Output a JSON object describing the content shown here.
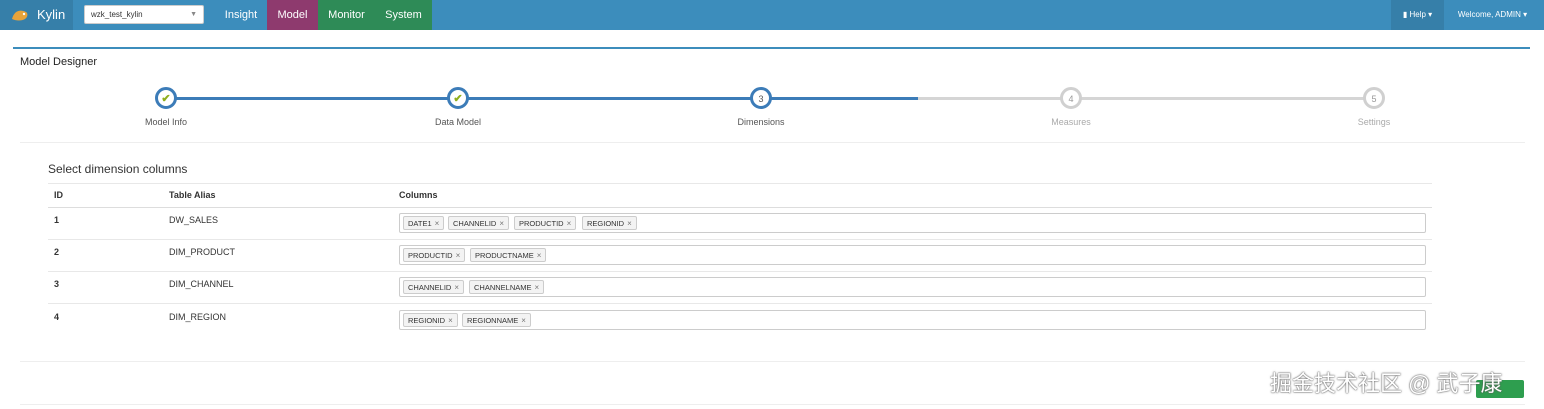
{
  "navbar": {
    "brand": "Kylin",
    "project": "wzk_test_kylin",
    "tabs": [
      "Insight",
      "Model",
      "Monitor",
      "System"
    ],
    "active_tab": "Model",
    "help": "Help",
    "welcome": "Welcome, ADMIN",
    "colors": {
      "bar": "#3c8dbc",
      "model_tab": "#8e3a6e",
      "green_tab": "#2e8b57"
    }
  },
  "page": {
    "title": "Model Designer"
  },
  "steps": [
    {
      "number": "1",
      "label": "Model Info",
      "state": "done"
    },
    {
      "number": "2",
      "label": "Data Model",
      "state": "done"
    },
    {
      "number": "3",
      "label": "Dimensions",
      "state": "active"
    },
    {
      "number": "4",
      "label": "Measures",
      "state": "pending"
    },
    {
      "number": "5",
      "label": "Settings",
      "state": "pending"
    }
  ],
  "dimensions": {
    "title": "Select dimension columns",
    "headers": {
      "id": "ID",
      "alias": "Table Alias",
      "columns": "Columns"
    },
    "rows": [
      {
        "id": "1",
        "alias": "DW_SALES",
        "columns": [
          "DATE1",
          "CHANNELID",
          "PRODUCTID",
          "REGIONID"
        ]
      },
      {
        "id": "2",
        "alias": "DIM_PRODUCT",
        "columns": [
          "PRODUCTID",
          "PRODUCTNAME"
        ]
      },
      {
        "id": "3",
        "alias": "DIM_CHANNEL",
        "columns": [
          "CHANNELID",
          "CHANNELNAME"
        ]
      },
      {
        "id": "4",
        "alias": "DIM_REGION",
        "columns": [
          "REGIONID",
          "REGIONNAME"
        ]
      }
    ]
  },
  "watermark": "掘金技术社区 @ 武子康"
}
